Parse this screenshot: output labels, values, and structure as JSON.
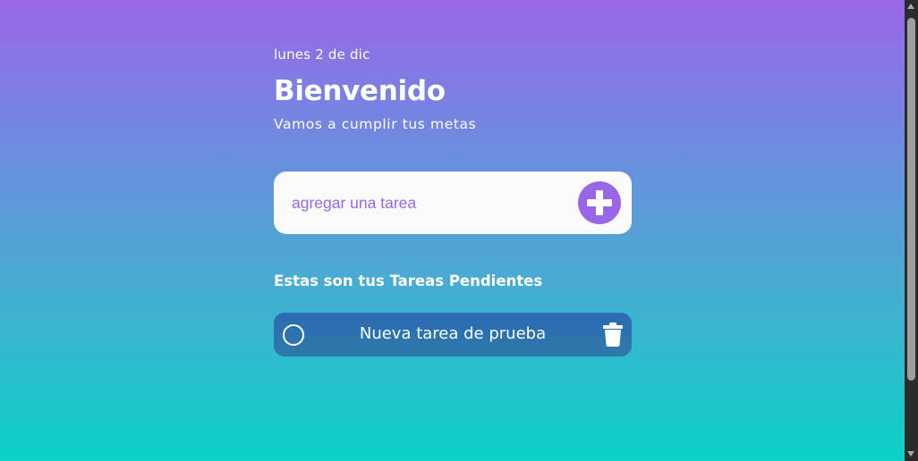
{
  "header": {
    "date": "lunes 2 de dic",
    "title": "Bienvenido",
    "subtitle": "Vamos a cumplir tus metas"
  },
  "task_form": {
    "placeholder": "agregar una tarea",
    "value": "",
    "add_icon": "plus-circle-icon"
  },
  "pending": {
    "heading": "Estas son tus Tareas Pendientes",
    "tasks": [
      {
        "text": "Nueva tarea de prueba",
        "completed": false,
        "check_icon": "circle-outline-icon",
        "delete_icon": "trash-icon"
      }
    ]
  },
  "colors": {
    "gradient_top": "#9a66e8",
    "gradient_bottom": "#0ad2c6",
    "accent": "#9a66e8",
    "task_bg": "#2b6ab5",
    "input_bg": "#fafafa"
  }
}
